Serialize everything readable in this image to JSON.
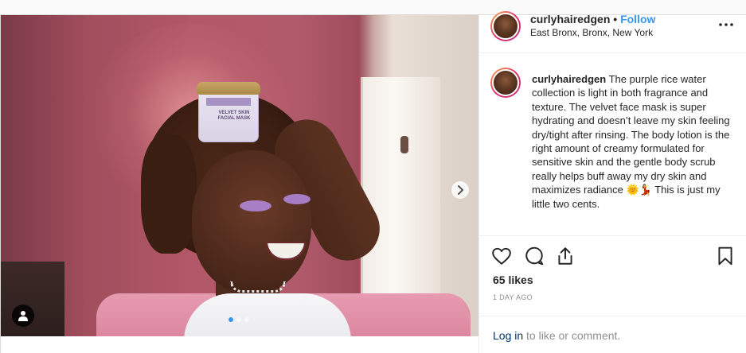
{
  "post": {
    "username": "curlyhairedgen",
    "separator": "•",
    "follow_label": "Follow",
    "location": "East Bronx, Bronx, New York",
    "caption_text": "The purple rice water collection is light in both fragrance and texture. The velvet face mask is super hydrating and doesn’t leave my skin feeling dry/tight after rinsing. The body lotion is the right amount of creamy formulated for sensitive skin and the gentle body scrub really helps buff away my dry skin and maximizes radiance 🌞💃 This is just my little two cents.",
    "likes": "65 likes",
    "time_ago": "1 DAY AGO",
    "login_link": "Log in",
    "login_suffix": " to like or comment."
  },
  "photo": {
    "jar_label": "VELVET SKIN FACIAL MASK",
    "carousel": {
      "total": 3,
      "active_index": 0
    }
  },
  "icons": {
    "more": "more-options-icon",
    "like": "heart-icon",
    "comment": "comment-icon",
    "share": "share-icon",
    "save": "bookmark-icon",
    "next": "chevron-right-icon",
    "tag": "user-tag-icon"
  },
  "colors": {
    "accent": "#3897f0",
    "text": "#262626",
    "muted": "#8e8e8e",
    "link": "#003569"
  }
}
